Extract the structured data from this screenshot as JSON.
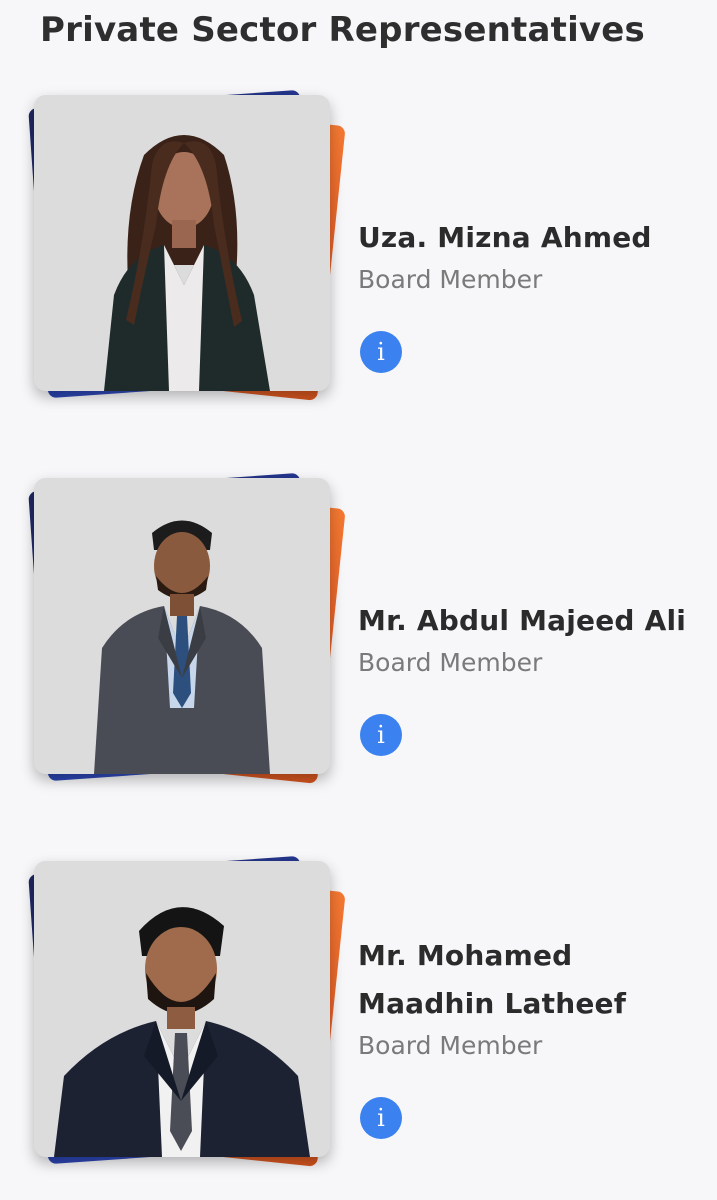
{
  "section": {
    "title": "Private Sector Representatives"
  },
  "members": [
    {
      "name_lines": [
        "Uza. Mizna Ahmed"
      ],
      "role": "Board Member",
      "info_icon": "info-icon"
    },
    {
      "name_lines": [
        "Mr. Abdul Majeed Ali"
      ],
      "role": "Board Member",
      "info_icon": "info-icon"
    },
    {
      "name_lines": [
        "Mr. Mohamed",
        "Maadhin Latheef"
      ],
      "role": "Board Member",
      "info_icon": "info-icon"
    }
  ],
  "colors": {
    "accent_orange": "#e8642a",
    "accent_blue": "#2840a8",
    "info_button": "#3b82f0",
    "background": "#f7f7f9"
  }
}
